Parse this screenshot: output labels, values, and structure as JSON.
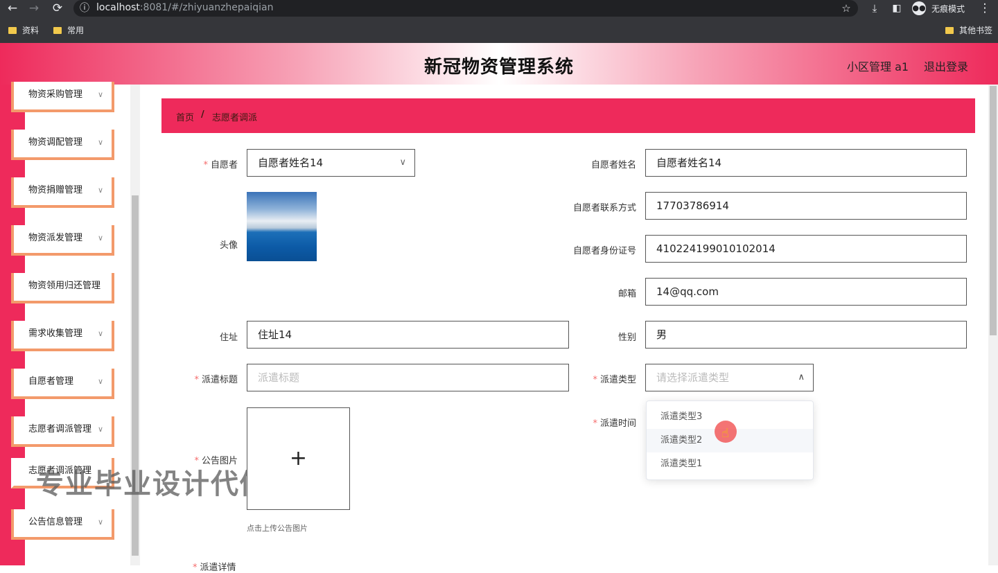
{
  "browser": {
    "url_host": "localhost",
    "url_rest": ":8081/#/zhiyuanzhepaiqian",
    "bookmarks": [
      "资料",
      "常用"
    ],
    "other_bookmarks": "其他书签",
    "incognito_label": "无痕模式"
  },
  "header": {
    "title": "新冠物资管理系统",
    "user": "小区管理 a1",
    "logout": "退出登录"
  },
  "sidebar": {
    "items": [
      {
        "label": "物资采购管理",
        "chevron": true
      },
      {
        "label": "物资调配管理",
        "chevron": true
      },
      {
        "label": "物资捐赠管理",
        "chevron": true
      },
      {
        "label": "物资派发管理",
        "chevron": true
      },
      {
        "label": "物资领用归还管理",
        "chevron": false
      },
      {
        "label": "需求收集管理",
        "chevron": true
      },
      {
        "label": "自愿者管理",
        "chevron": true
      },
      {
        "label": "志愿者调派管理",
        "chevron": true
      },
      {
        "label": "志愿者调派管理",
        "chevron": false
      },
      {
        "label": "公告信息管理",
        "chevron": true
      }
    ],
    "watermark": "专业毕业设计代做"
  },
  "breadcrumb": {
    "home": "首页",
    "separator": "/",
    "current": "志愿者调派"
  },
  "form": {
    "volunteer_label": "自愿者",
    "volunteer_value": "自愿者姓名14",
    "avatar_label": "头像",
    "name_label": "自愿者姓名",
    "name_value": "自愿者姓名14",
    "phone_label": "自愿者联系方式",
    "phone_value": "17703786914",
    "idcard_label": "自愿者身份证号",
    "idcard_value": "410224199010102014",
    "email_label": "邮箱",
    "email_value": "14@qq.com",
    "address_label": "住址",
    "address_value": "住址14",
    "gender_label": "性别",
    "gender_value": "男",
    "dispatch_title_label": "派遣标题",
    "dispatch_title_placeholder": "派遣标题",
    "dispatch_type_label": "派遣类型",
    "dispatch_type_placeholder": "请选择派遣类型",
    "dispatch_time_label": "派遣时间",
    "notice_image_label": "公告图片",
    "upload_plus": "+",
    "upload_tip": "点击上传公告图片",
    "dispatch_detail_label": "派遣详情"
  },
  "dropdown": {
    "options": [
      "派遣类型3",
      "派遣类型2",
      "派遣类型1"
    ],
    "hovered_index": 1
  },
  "colors": {
    "accent": "#ee2a5b",
    "menu_border": "#f39a6b",
    "required": "#f56c6c"
  }
}
